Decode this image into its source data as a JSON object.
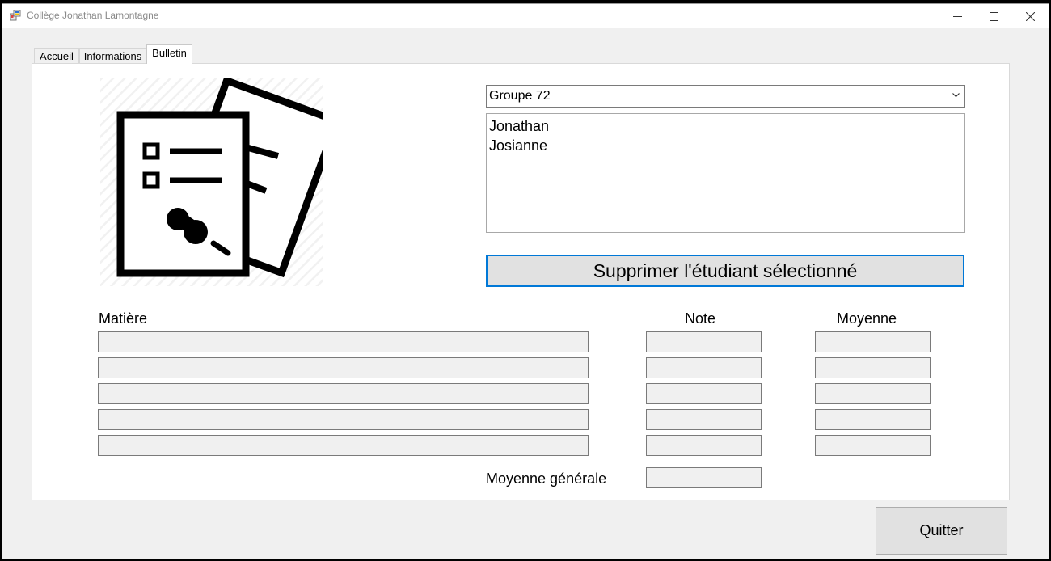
{
  "window": {
    "title": "Collège Jonathan Lamontagne"
  },
  "tabs": [
    {
      "label": "Accueil"
    },
    {
      "label": "Informations"
    },
    {
      "label": "Bulletin"
    }
  ],
  "active_tab": "Bulletin",
  "group_select": {
    "value": "Groupe 72"
  },
  "students": [
    {
      "name": "Jonathan"
    },
    {
      "name": "Josianne"
    }
  ],
  "delete_button": {
    "label": "Supprimer l'étudiant sélectionné"
  },
  "grades": {
    "headers": {
      "subject": "Matière",
      "note": "Note",
      "average": "Moyenne"
    },
    "rows": [
      {
        "subject": "",
        "note": "",
        "average": ""
      },
      {
        "subject": "",
        "note": "",
        "average": ""
      },
      {
        "subject": "",
        "note": "",
        "average": ""
      },
      {
        "subject": "",
        "note": "",
        "average": ""
      },
      {
        "subject": "",
        "note": "",
        "average": ""
      }
    ],
    "overall_label": "Moyenne générale",
    "overall_value": ""
  },
  "quit_button": {
    "label": "Quitter"
  },
  "icons": {
    "app": "app-icon",
    "minimize": "minimize-icon",
    "maximize": "maximize-icon",
    "close": "close-icon",
    "illustration": "report-card-documents-icon",
    "dropdown": "chevron-down-icon"
  }
}
